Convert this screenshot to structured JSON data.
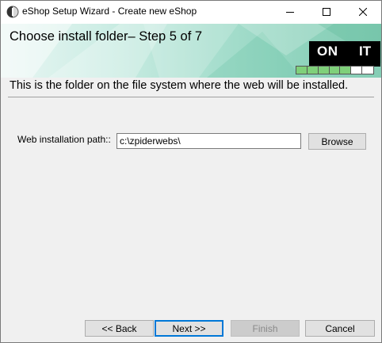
{
  "window": {
    "title": "eShop Setup Wizard - Create new eShop",
    "controls": {
      "minimize": "minimize-icon",
      "maximize": "maximize-icon",
      "close": "close-icon"
    }
  },
  "banner": {
    "title": "Choose install folder– Step 5 of 7",
    "logo_left": "ON",
    "logo_right": "IT",
    "progress": {
      "completed_steps": 5,
      "total_steps": 7
    }
  },
  "description": "This is the folder on the file system where the web will be installed.",
  "form": {
    "path_label": "Web installation path::",
    "path_value": "c:\\zpiderwebs\\",
    "browse_label": "Browse"
  },
  "buttons": {
    "back": "<< Back",
    "next": "Next >>",
    "finish": "Finish",
    "cancel": "Cancel"
  },
  "colors": {
    "accent": "#0078d7",
    "progress_done": "#7fd07a",
    "banner_green": "#85cdb5"
  }
}
